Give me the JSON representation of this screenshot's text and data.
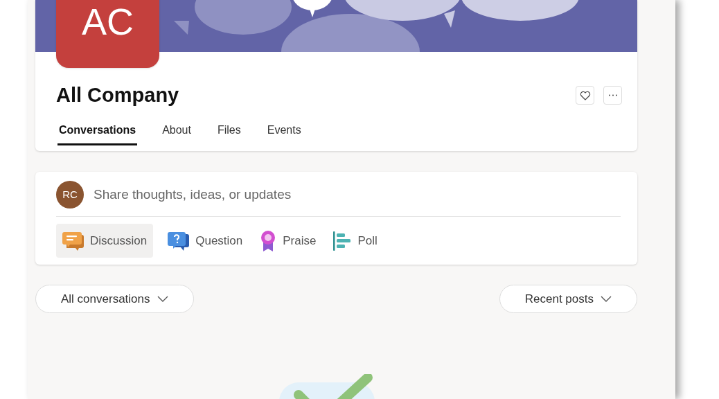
{
  "group": {
    "initials": "AC",
    "name": "All Company"
  },
  "tabs": [
    {
      "label": "Conversations",
      "selected": true
    },
    {
      "label": "About",
      "selected": false
    },
    {
      "label": "Files",
      "selected": false
    },
    {
      "label": "Events",
      "selected": false
    }
  ],
  "composer": {
    "avatar": "RC",
    "placeholder": "Share thoughts, ideas, or updates"
  },
  "post_types": [
    {
      "label": "Discussion",
      "kind": "discussion",
      "selected": true
    },
    {
      "label": "Question",
      "kind": "question",
      "selected": false
    },
    {
      "label": "Praise",
      "kind": "praise",
      "selected": false
    },
    {
      "label": "Poll",
      "kind": "poll",
      "selected": false
    }
  ],
  "filters": [
    {
      "label": "All conversations"
    },
    {
      "label": "Recent posts"
    }
  ]
}
